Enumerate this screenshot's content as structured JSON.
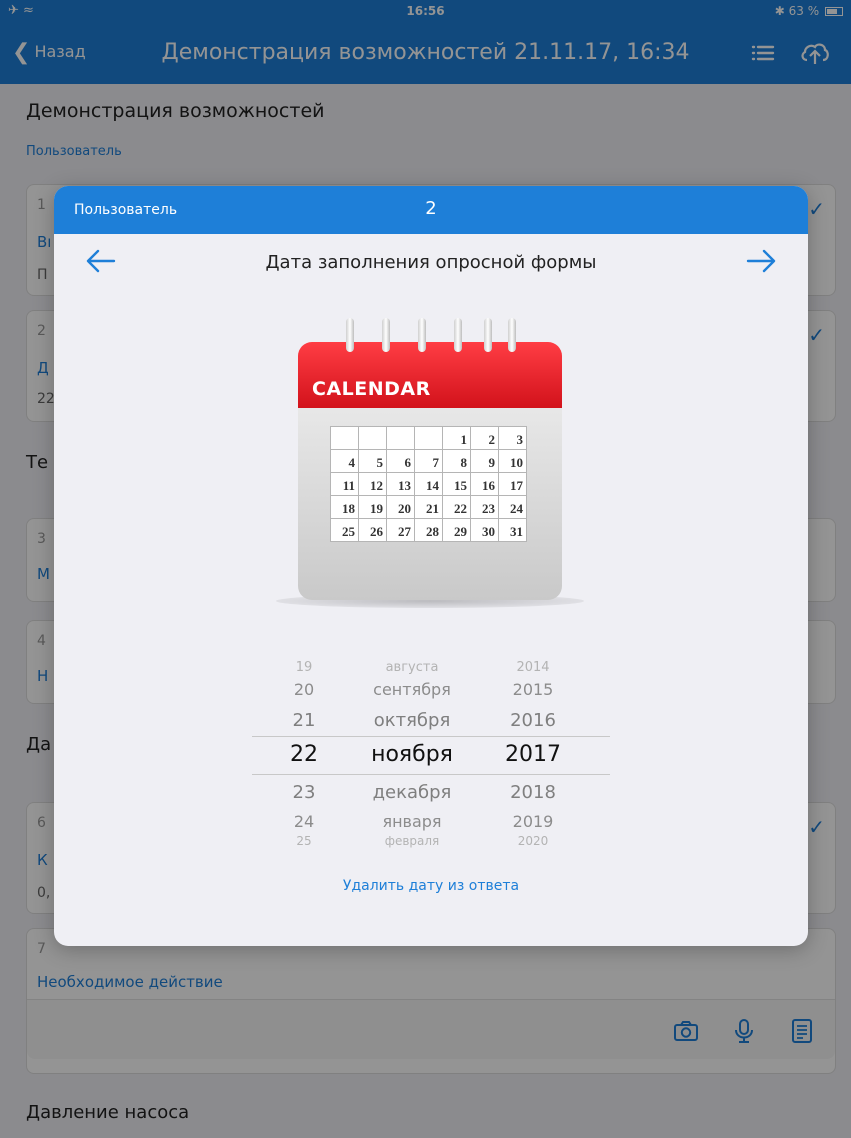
{
  "status_bar": {
    "left": "✈ ︎≈",
    "time": "16:56",
    "battery": "63 %"
  },
  "nav": {
    "back_label": "Назад",
    "title": "Демонстрация возможностей 21.11.17, 16:34"
  },
  "page": {
    "title": "Демонстрация возможностей",
    "user_label": "Пользователь",
    "cards": [
      {
        "num": "1",
        "link": "Вı",
        "value": "П"
      },
      {
        "num": "2",
        "link": "Д",
        "value": "22"
      },
      {
        "num": "3",
        "link": "М"
      },
      {
        "num": "4",
        "link": "Н"
      },
      {
        "num": "6",
        "link": "К",
        "value": "0,"
      },
      {
        "num": "7",
        "link": "Необходимое действие"
      }
    ],
    "sections": [
      "Те",
      "Да",
      "Давление насоса"
    ]
  },
  "modal": {
    "user_label": "Пользователь",
    "page_number": "2",
    "question": "Дата заполнения опросной формы",
    "calendar_label": "CALENDAR",
    "calendar_rows": [
      [
        "",
        "",
        "",
        "",
        "1",
        "2",
        "3"
      ],
      [
        "4",
        "5",
        "6",
        "7",
        "8",
        "9",
        "10"
      ],
      [
        "11",
        "12",
        "13",
        "14",
        "15",
        "16",
        "17"
      ],
      [
        "18",
        "19",
        "20",
        "21",
        "22",
        "23",
        "24"
      ],
      [
        "25",
        "26",
        "27",
        "28",
        "29",
        "30",
        "31"
      ]
    ],
    "picker": {
      "days": [
        "19",
        "20",
        "21",
        "22",
        "23",
        "24",
        "25"
      ],
      "months": [
        "августа",
        "сентября",
        "октября",
        "ноября",
        "декабря",
        "января",
        "февраля"
      ],
      "years": [
        "2014",
        "2015",
        "2016",
        "2017",
        "2018",
        "2019",
        "2020"
      ],
      "selected": {
        "day": "22",
        "month": "ноября",
        "year": "2017"
      }
    },
    "delete_label": "Удалить дату из ответа"
  },
  "colors": {
    "accent": "#1e7fd8",
    "calendar_red": "#e3242b"
  }
}
